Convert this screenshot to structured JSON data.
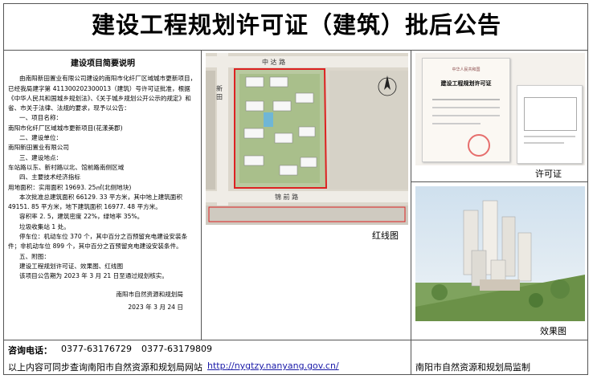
{
  "title": "建设工程规划许可证（建筑）批后公告",
  "summary": {
    "heading": "建设项目简要说明",
    "intro": "由南阳新田置业有限公司建设的南阳市化纤厂区域城市更新项目，已经我局建字第 411300202300013（建筑）号许可证批准，根据《中华人民共和国城乡规划法》、《关于城乡规划公开公示的规定》和省、市关于法律、法规的要求，现予以公告：",
    "s1_title": "一、项目名称：",
    "s1_value": "南阳市化纤厂区域城市更新项目(花漾美郡)",
    "s2_title": "二、建设单位：",
    "s2_value": "南阳新田置业有限公司",
    "s3_title": "三、建设地点：",
    "s3_value": "车站路以东、新村路以北、馆前路南侧区域",
    "s4_title": "四、主要技术经济指标",
    "land_area": "用地面积：实用面积 19693. 25㎡(北侧地块)",
    "approval": "本次批准总建筑面积 66129. 33 平方米，其中地上建筑面积 49151. 85 平方米，地下建筑面积 16977. 48 平方米。",
    "ratios": "容积率 2. 5，建筑密度 22%，绿地率 35%。",
    "garbage": "垃圾收集站 1 处。",
    "parking": "停车位：机动车位 370 个，其中百分之百预留充电建设安装条件；非机动车位 899 个，其中百分之百预留充电建设安装条件。",
    "s5_title": "五、附图：",
    "s5_value": "建设工程规划许可证、效果图、红线图",
    "notice_date": "该项目公告期为 2023 年 3 月 21 日至通过规划核实。",
    "issuer": "南阳市自然资源和规划局",
    "issue_date": "2023 年 3 月 24 日"
  },
  "map": {
    "caption": "红线图",
    "road_top": "中 达 路",
    "road_bottom": "锦 前 路",
    "road_left": "新 田"
  },
  "permit": {
    "caption": "许可证",
    "doc_header": "中华人民共和国",
    "doc_title": "建设工程规划许可证"
  },
  "render": {
    "caption": "效果图"
  },
  "footer": {
    "phone_label": "咨询电话：",
    "phone1": "0377-63176729",
    "phone2": "0377-63179809",
    "query_text": "以上内容可同步查询南阳市自然资源和规划局网站",
    "url": "http://nygtzy.nanyang.gov.cn/",
    "supervisor": "南阳市自然资源和规划局监制"
  }
}
